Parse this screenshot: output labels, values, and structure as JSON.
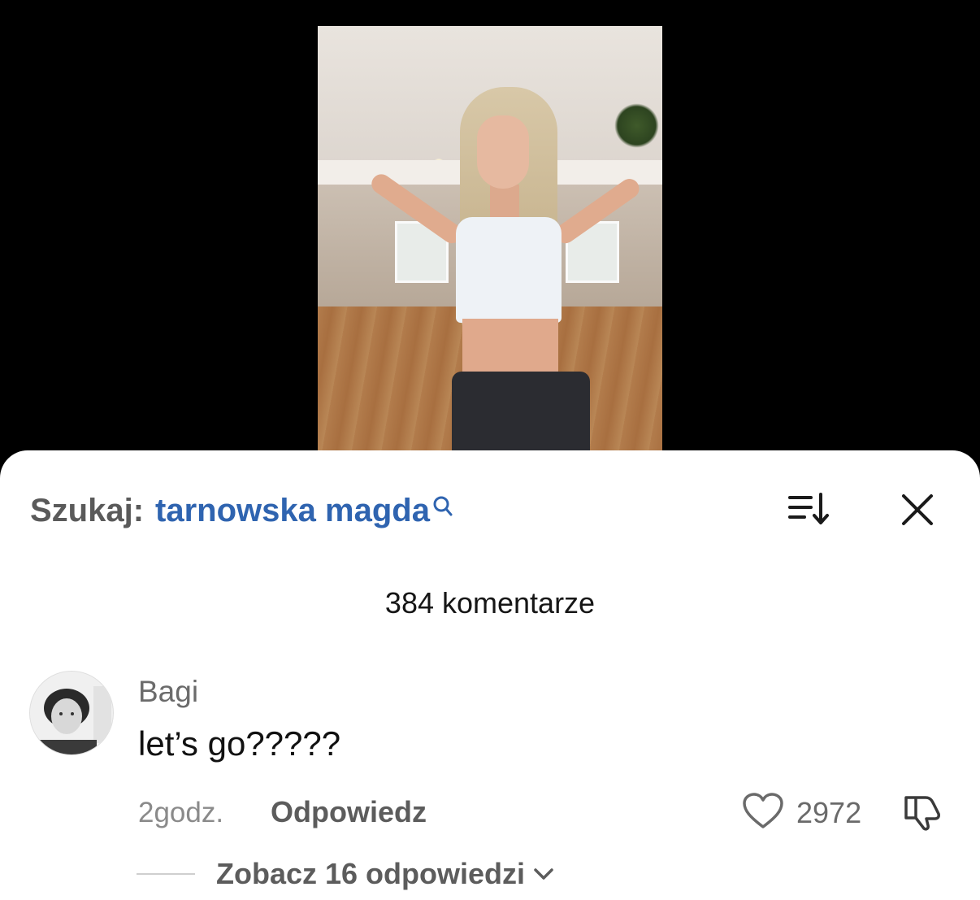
{
  "search": {
    "label": "Szukaj:",
    "query": "tarnowska magda"
  },
  "comments": {
    "count_label": "384 komentarze"
  },
  "comment": {
    "username": "Bagi",
    "text": "let’s go?????",
    "time": "2godz.",
    "reply_label": "Odpowiedz",
    "likes": "2972",
    "view_replies_label": "Zobacz 16 odpowiedzi"
  },
  "icons": {
    "search": "search-icon",
    "sort": "sort-icon",
    "close": "close-icon",
    "like": "heart-icon",
    "dislike": "thumbs-down-icon",
    "expand": "chevron-down-icon"
  },
  "colors": {
    "query": "#2f64b0",
    "sheet_background": "#ffffff",
    "video_background": "#000000"
  }
}
